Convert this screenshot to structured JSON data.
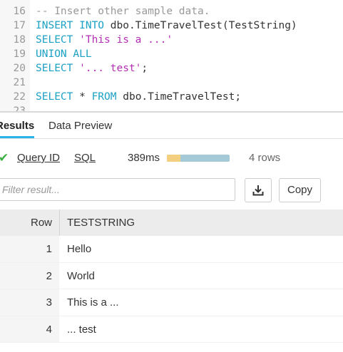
{
  "editor": {
    "lines": [
      {
        "num": "16",
        "tokens": [
          {
            "t": "-- Insert other sample data.",
            "c": "cm"
          }
        ]
      },
      {
        "num": "17",
        "tokens": [
          {
            "t": "INSERT INTO ",
            "c": "kw"
          },
          {
            "t": "dbo.TimeTravelTest(TestString)",
            "c": "txt"
          }
        ]
      },
      {
        "num": "18",
        "tokens": [
          {
            "t": "SELECT ",
            "c": "kw"
          },
          {
            "t": "'This is a ...'",
            "c": "str"
          }
        ]
      },
      {
        "num": "19",
        "tokens": [
          {
            "t": "UNION ALL",
            "c": "kw"
          }
        ]
      },
      {
        "num": "20",
        "tokens": [
          {
            "t": "SELECT ",
            "c": "kw"
          },
          {
            "t": "'... test'",
            "c": "str"
          },
          {
            "t": ";",
            "c": "txt"
          }
        ]
      },
      {
        "num": "21",
        "tokens": []
      },
      {
        "num": "22",
        "tokens": [
          {
            "t": "SELECT ",
            "c": "kw"
          },
          {
            "t": "* ",
            "c": "txt"
          },
          {
            "t": "FROM ",
            "c": "kw"
          },
          {
            "t": "dbo.TimeTravelTest;",
            "c": "txt"
          }
        ]
      },
      {
        "num": "23",
        "tokens": []
      }
    ]
  },
  "tabs": {
    "results": "Results",
    "preview": "Data Preview"
  },
  "stats": {
    "query_id": "Query ID",
    "sql": "SQL",
    "duration": "389ms",
    "bar_split": 0.22,
    "rows": "4 rows"
  },
  "filter": {
    "placeholder": "Filter result..."
  },
  "buttons": {
    "copy": "Copy"
  },
  "table": {
    "headers": {
      "row": "Row",
      "col": "TESTSTRING"
    },
    "rows": [
      {
        "n": "1",
        "v": "Hello"
      },
      {
        "n": "2",
        "v": "World"
      },
      {
        "n": "3",
        "v": "This is a ..."
      },
      {
        "n": "4",
        "v": "... test"
      }
    ]
  },
  "colors": {
    "keyword": "#1ba1c4",
    "string": "#b42fb4",
    "comment": "#999999",
    "accent": "#29b5e8",
    "success": "#3cb043"
  }
}
